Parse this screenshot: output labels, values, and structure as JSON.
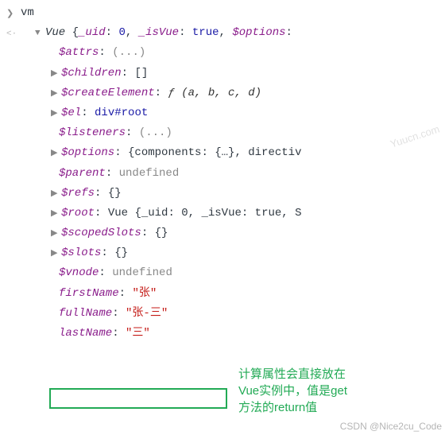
{
  "input": {
    "expr": "vm"
  },
  "summary": {
    "ctor": "Vue",
    "preview": "{_uid: 0, _isVue: true, $options:"
  },
  "props": {
    "attrs": {
      "key": "$attrs",
      "value": "(...)"
    },
    "children": {
      "key": "$children",
      "value": "[]"
    },
    "createElement": {
      "key": "$createElement",
      "sig": "ƒ (a, b, c, d)"
    },
    "el": {
      "key": "$el",
      "tag": "div",
      "id": "#root"
    },
    "listeners": {
      "key": "$listeners",
      "value": "(...)"
    },
    "options": {
      "key": "$options",
      "preview": "{components: {…}, directiv"
    },
    "parent": {
      "key": "$parent",
      "value": "undefined"
    },
    "refs": {
      "key": "$refs",
      "value": "{}"
    },
    "root": {
      "key": "$root",
      "ctor": "Vue",
      "preview": "{_uid: 0, _isVue: true, S"
    },
    "scopedSlots": {
      "key": "$scopedSlots",
      "value": "{}"
    },
    "slots": {
      "key": "$slots",
      "value": "{}"
    },
    "vnode": {
      "key": "$vnode",
      "value": "undefined"
    },
    "firstName": {
      "key": "firstName",
      "value": "\"张\""
    },
    "fullName": {
      "key": "fullName",
      "value": "\"张-三\""
    },
    "lastName": {
      "key": "lastName",
      "value": "\"三\""
    }
  },
  "preview_parts": {
    "uid": "_uid",
    "uid_v": "0",
    "isVue": "_isVue",
    "isVue_v": "true",
    "opts": "$options"
  },
  "annotation": "计算属性会直接放在\nVue实例中，值是get\n方法的return值",
  "watermark1": "Yuucn.com",
  "watermark2": "CSDN @Nice2cu_Code"
}
